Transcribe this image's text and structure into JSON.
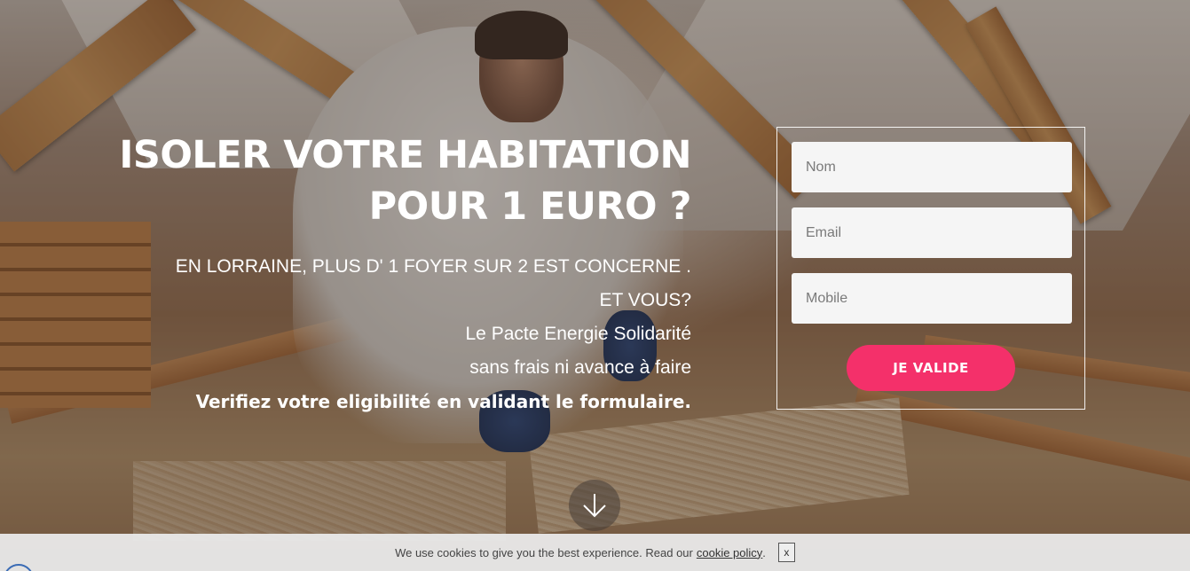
{
  "hero": {
    "headline_line1": "ISOLER VOTRE HABITATION",
    "headline_line2": "POUR 1 EURO ?",
    "sub_line1": "EN LORRAINE, PLUS D' 1 FOYER SUR 2 EST CONCERNE .",
    "sub_line2": "ET VOUS?",
    "sub_line3": "Le Pacte Energie Solidarité",
    "sub_line4": "sans frais ni avance à faire",
    "sub_line5": "Verifiez votre eligibilité en validant le formulaire."
  },
  "form": {
    "name_placeholder": "Nom",
    "email_placeholder": "Email",
    "mobile_placeholder": "Mobile",
    "submit_label": "JE VALIDE"
  },
  "cookie": {
    "text": "We use cookies to give you the best experience. Read our",
    "link_label": "cookie policy",
    "after_link": ".",
    "close_label": "x"
  },
  "colors": {
    "accent": "#f4306a",
    "field_bg": "#f5f5f5",
    "cookie_bg": "#e8e8e8"
  },
  "icons": {
    "scroll": "arrow-down-icon"
  }
}
